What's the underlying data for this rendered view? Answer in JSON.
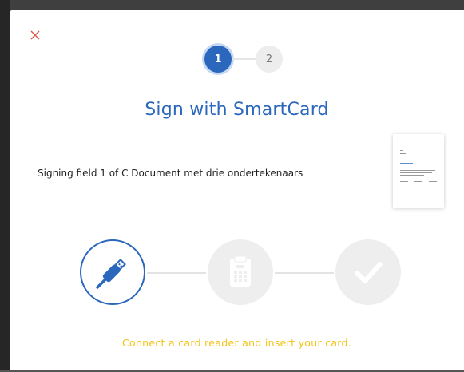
{
  "dialog": {
    "close_label": "×",
    "steps": [
      "1",
      "2"
    ],
    "current_step": 1,
    "title": "Sign with SmartCard",
    "signing_info": "Signing field 1 of C Document met drie ondertekenaars",
    "progress": [
      {
        "icon": "usb-icon",
        "state": "active"
      },
      {
        "icon": "card-reader-icon",
        "state": "pending"
      },
      {
        "icon": "checkmark-icon",
        "state": "pending"
      }
    ],
    "instruction": "Connect a card reader and insert your card."
  },
  "colors": {
    "accent": "#2a67bd",
    "close": "#e0564a",
    "instruction": "#f3c316",
    "inactive": "#eeeeee"
  }
}
